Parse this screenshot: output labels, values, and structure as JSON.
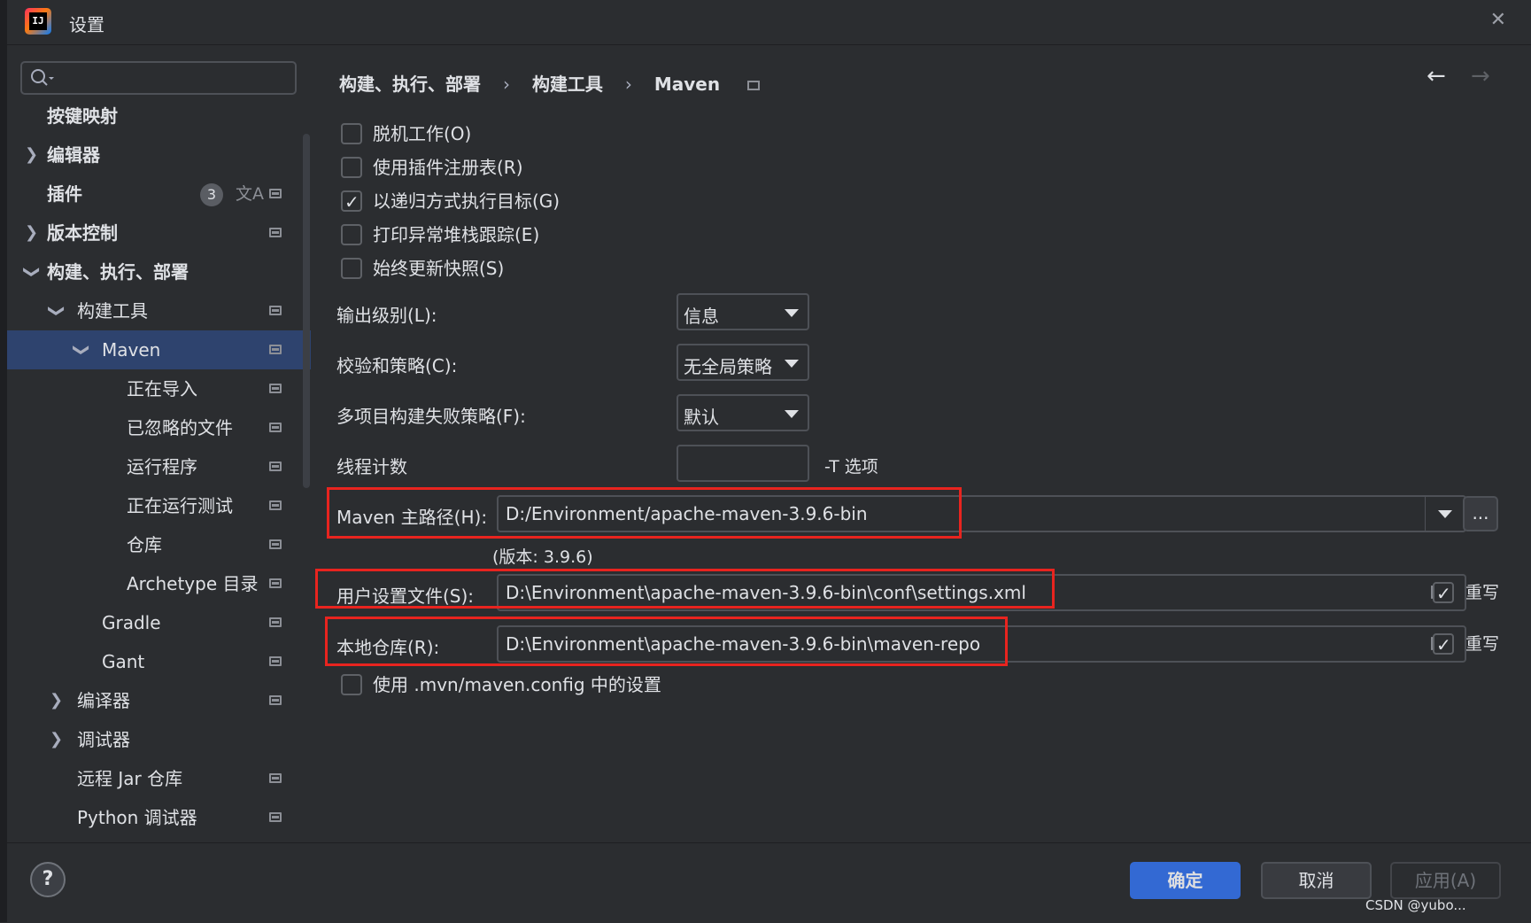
{
  "window": {
    "title": "设置"
  },
  "sidebar": {
    "search_placeholder": "",
    "plugins_badge": "3",
    "items": [
      {
        "label": "按键映射"
      },
      {
        "label": "编辑器"
      },
      {
        "label": "插件"
      },
      {
        "label": "版本控制"
      },
      {
        "label": "构建、执行、部署"
      },
      {
        "label": "构建工具"
      },
      {
        "label": "Maven"
      },
      {
        "label": "正在导入"
      },
      {
        "label": "已忽略的文件"
      },
      {
        "label": "运行程序"
      },
      {
        "label": "正在运行测试"
      },
      {
        "label": "仓库"
      },
      {
        "label": "Archetype 目录"
      },
      {
        "label": "Gradle"
      },
      {
        "label": "Gant"
      },
      {
        "label": "编译器"
      },
      {
        "label": "调试器"
      },
      {
        "label": "远程 Jar 仓库"
      },
      {
        "label": "Python 调试器"
      }
    ]
  },
  "breadcrumb": [
    "构建、执行、部署",
    "构建工具",
    "Maven"
  ],
  "options": [
    {
      "label": "脱机工作(O)",
      "checked": false
    },
    {
      "label": "使用插件注册表(R)",
      "checked": false
    },
    {
      "label": "以递归方式执行目标(G)",
      "checked": true
    },
    {
      "label": "打印异常堆栈跟踪(E)",
      "checked": false
    },
    {
      "label": "始终更新快照(S)",
      "checked": false
    }
  ],
  "form": {
    "output_level": {
      "label": "输出级别(L):",
      "value": "信息"
    },
    "checksum_policy": {
      "label": "校验和策略(C):",
      "value": "无全局策略"
    },
    "multiproject_fail": {
      "label": "多项目构建失败策略(F):",
      "value": "默认"
    },
    "thread_count": {
      "label": "线程计数",
      "value": "",
      "hint": "-T 选项"
    },
    "maven_home": {
      "label": "Maven 主路径(H):",
      "value": "D:/Environment/apache-maven-3.9.6-bin",
      "version": "(版本: 3.9.6)",
      "browse": "..."
    },
    "user_settings": {
      "label": "用户设置文件(S):",
      "value": "D:\\Environment\\apache-maven-3.9.6-bin\\conf\\settings.xml",
      "override_label": "重写",
      "override": true
    },
    "local_repo": {
      "label": "本地仓库(R):",
      "value": "D:\\Environment\\apache-maven-3.9.6-bin\\maven-repo",
      "override_label": "重写",
      "override": true
    },
    "use_mvn_config": {
      "label": "使用 .mvn/maven.config 中的设置",
      "checked": false
    }
  },
  "footer": {
    "help": "?",
    "ok": "确定",
    "cancel": "取消",
    "apply": "应用(A)"
  },
  "watermark": "CSDN @yubo..."
}
